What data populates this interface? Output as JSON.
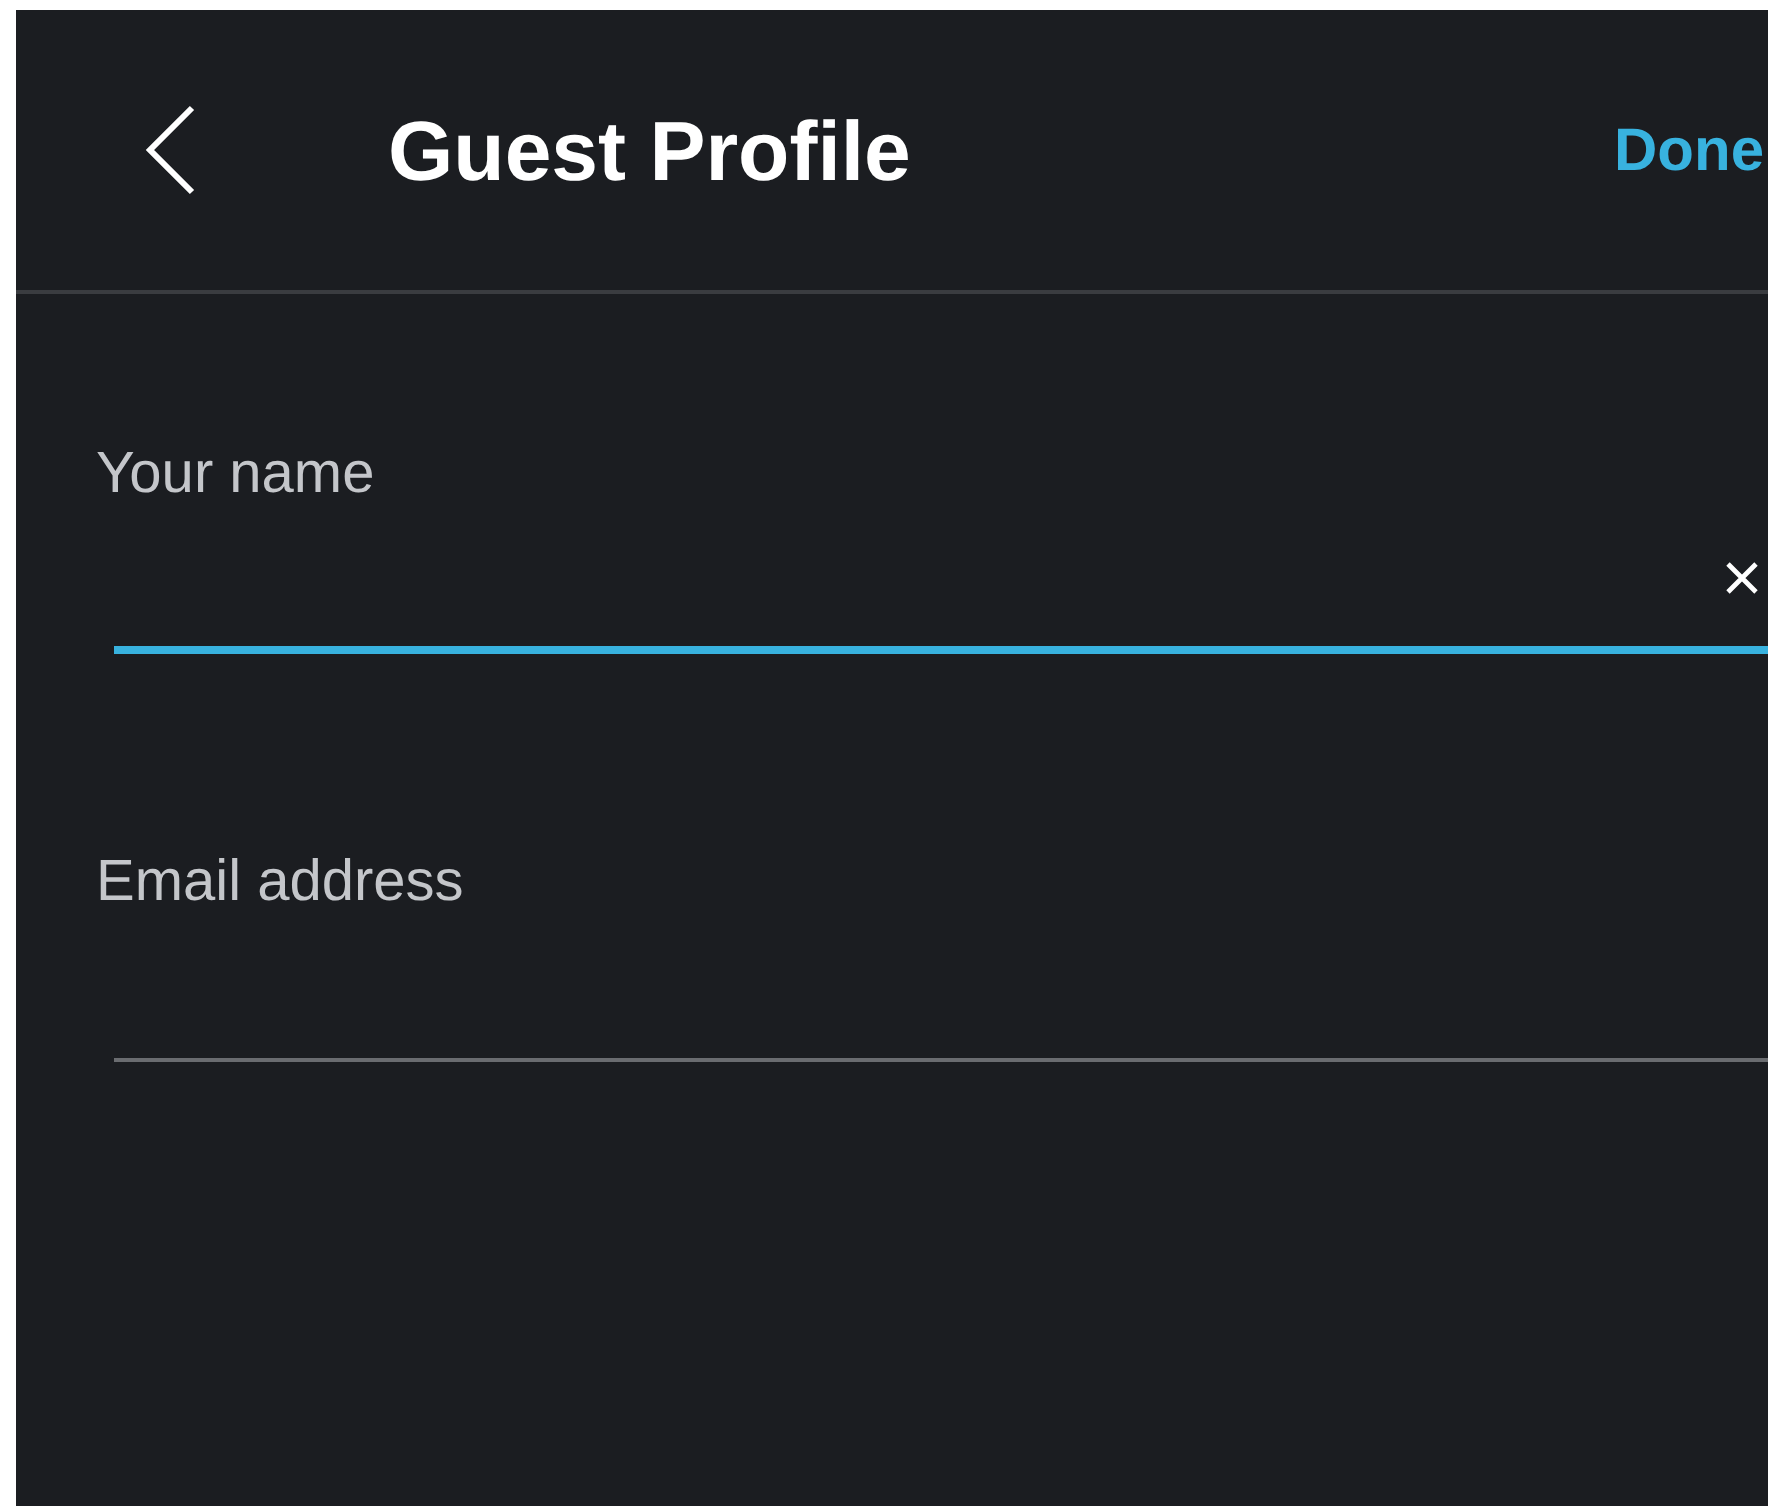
{
  "header": {
    "title": "Guest Profile",
    "done": "Done"
  },
  "fields": [
    {
      "label": "Your name",
      "focused": true
    },
    {
      "label": "Email address",
      "focused": false
    }
  ]
}
